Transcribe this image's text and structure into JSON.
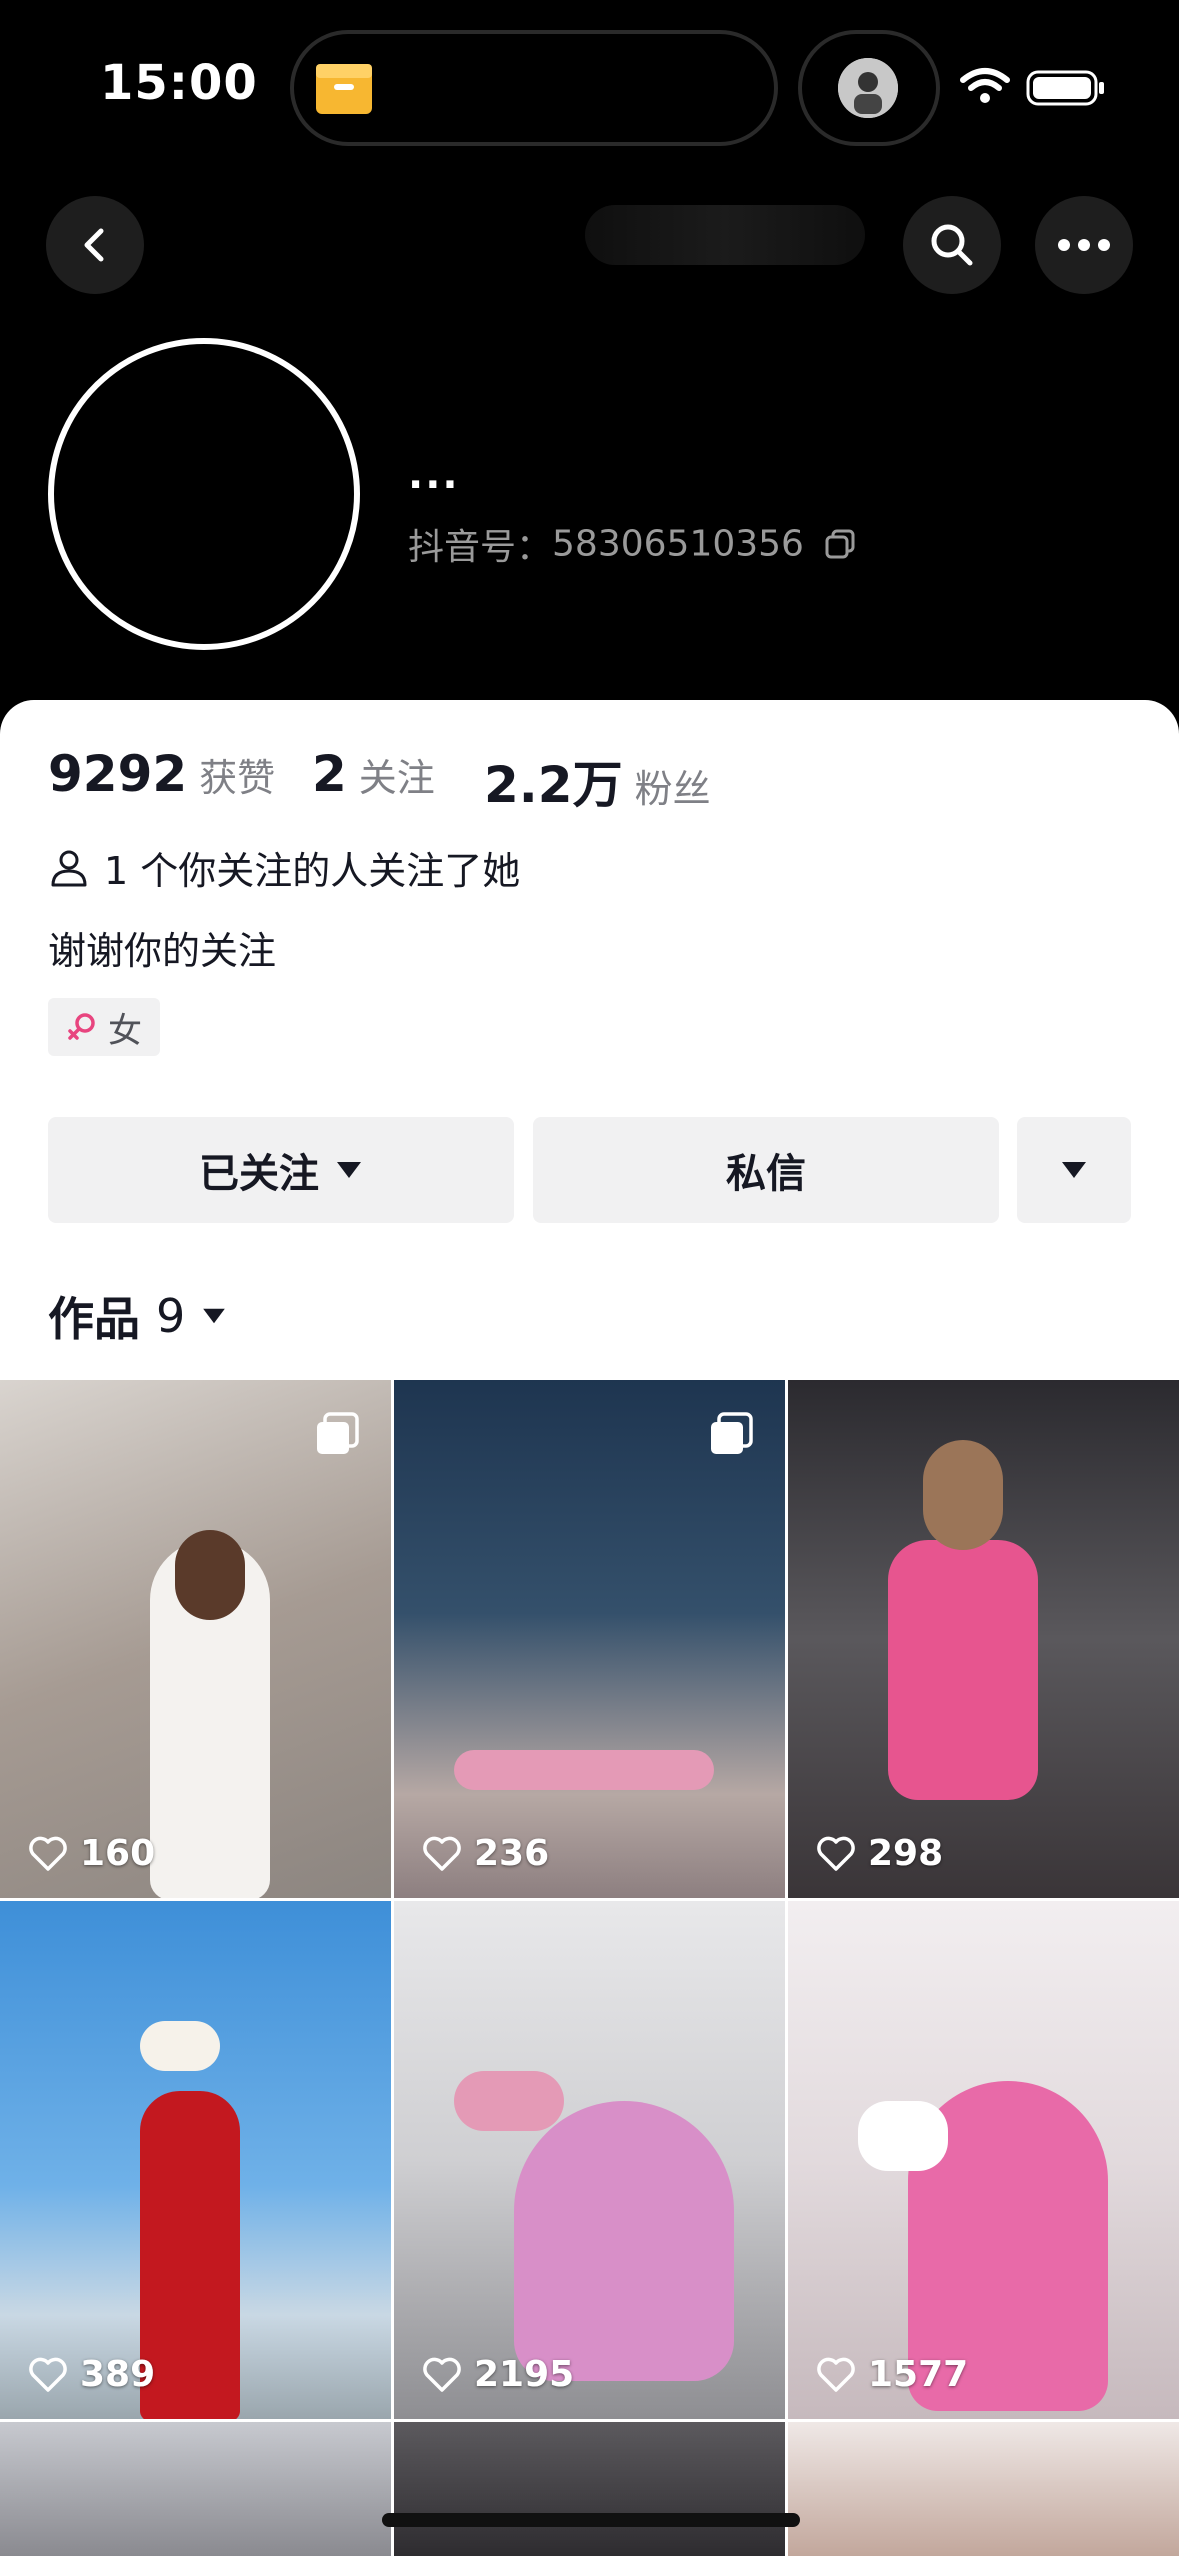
{
  "status_bar": {
    "time": "15:00"
  },
  "profile": {
    "nickname": "...",
    "douyin_id_label": "抖音号：",
    "douyin_id": "58306510356",
    "stats": [
      {
        "value": "9292",
        "label": "获赞"
      },
      {
        "value": "2",
        "label": "关注"
      },
      {
        "value": "2.2万",
        "label": "粉丝"
      }
    ],
    "mutual_text": "1 个你关注的人关注了她",
    "bio": "谢谢你的关注",
    "gender": "女"
  },
  "actions": {
    "follow_label": "已关注",
    "message_label": "私信"
  },
  "works": {
    "label": "作品",
    "count": "9",
    "items": [
      {
        "likes": "160",
        "multi": true
      },
      {
        "likes": "236",
        "multi": true
      },
      {
        "likes": "298",
        "multi": false
      },
      {
        "likes": "389",
        "multi": false
      },
      {
        "likes": "2195",
        "multi": false
      },
      {
        "likes": "1577",
        "multi": false
      }
    ]
  },
  "colors": {
    "accent_pink": "#e8457f",
    "card_bg": "#ffffff",
    "button_bg": "#f1f1f2"
  }
}
